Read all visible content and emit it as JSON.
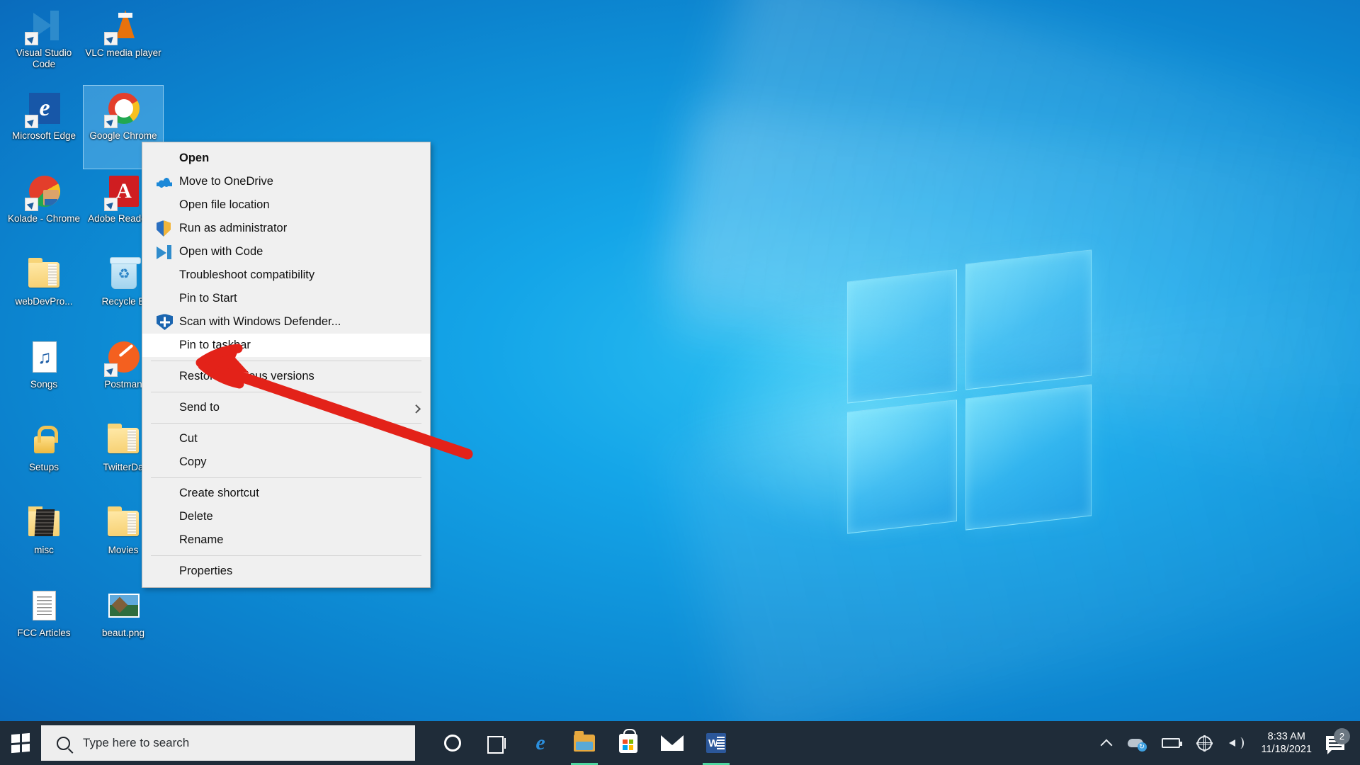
{
  "desktop": {
    "icons": [
      {
        "label": "Visual Studio Code",
        "art": "vscode",
        "shortcut": true,
        "selected": false
      },
      {
        "label": "VLC media player",
        "art": "vlc",
        "shortcut": true,
        "selected": false
      },
      {
        "label": "Microsoft Edge",
        "art": "edge",
        "shortcut": true,
        "selected": false
      },
      {
        "label": "Google Chrome",
        "art": "chrome",
        "shortcut": true,
        "selected": true
      },
      {
        "label": "Kolade - Chrome",
        "art": "kolade",
        "shortcut": true,
        "selected": false
      },
      {
        "label": "Adobe Reader X",
        "art": "acrobat",
        "shortcut": true,
        "selected": false
      },
      {
        "label": "webDevPro...",
        "art": "folder",
        "shortcut": false,
        "selected": false
      },
      {
        "label": "Recycle B",
        "art": "recycle",
        "shortcut": false,
        "selected": false
      },
      {
        "label": "Songs",
        "art": "music",
        "shortcut": false,
        "selected": false
      },
      {
        "label": "Postman",
        "art": "postman",
        "shortcut": true,
        "selected": false
      },
      {
        "label": "Setups",
        "art": "lock",
        "shortcut": false,
        "selected": false
      },
      {
        "label": "TwitterDa",
        "art": "folder",
        "shortcut": false,
        "selected": false
      },
      {
        "label": "misc",
        "art": "darkfolder",
        "shortcut": false,
        "selected": false
      },
      {
        "label": "Movies",
        "art": "folder",
        "shortcut": false,
        "selected": false
      },
      {
        "label": "FCC Articles",
        "art": "docstack",
        "shortcut": false,
        "selected": false
      },
      {
        "label": "beaut.png",
        "art": "photo",
        "shortcut": false,
        "selected": false
      }
    ]
  },
  "context_menu": {
    "items": [
      {
        "label": "Open",
        "icon": null,
        "bold": true,
        "highlighted": false,
        "submenu": false
      },
      {
        "label": "Move to OneDrive",
        "icon": "onedrive-icon",
        "bold": false,
        "highlighted": false,
        "submenu": false
      },
      {
        "label": "Open file location",
        "icon": null,
        "bold": false,
        "highlighted": false,
        "submenu": false
      },
      {
        "label": "Run as administrator",
        "icon": "shield-icon",
        "bold": false,
        "highlighted": false,
        "submenu": false
      },
      {
        "label": "Open with Code",
        "icon": "vscode-icon",
        "bold": false,
        "highlighted": false,
        "submenu": false
      },
      {
        "label": "Troubleshoot compatibility",
        "icon": null,
        "bold": false,
        "highlighted": false,
        "submenu": false
      },
      {
        "label": "Pin to Start",
        "icon": null,
        "bold": false,
        "highlighted": false,
        "submenu": false
      },
      {
        "label": "Scan with Windows Defender...",
        "icon": "defender-icon",
        "bold": false,
        "highlighted": false,
        "submenu": false
      },
      {
        "label": "Pin to taskbar",
        "icon": null,
        "bold": false,
        "highlighted": true,
        "submenu": false
      },
      {
        "separator": true
      },
      {
        "label": "Restore previous versions",
        "icon": null,
        "bold": false,
        "highlighted": false,
        "submenu": false
      },
      {
        "separator": true
      },
      {
        "label": "Send to",
        "icon": null,
        "bold": false,
        "highlighted": false,
        "submenu": true
      },
      {
        "separator": true
      },
      {
        "label": "Cut",
        "icon": null,
        "bold": false,
        "highlighted": false,
        "submenu": false
      },
      {
        "label": "Copy",
        "icon": null,
        "bold": false,
        "highlighted": false,
        "submenu": false
      },
      {
        "separator": true
      },
      {
        "label": "Create shortcut",
        "icon": null,
        "bold": false,
        "highlighted": false,
        "submenu": false
      },
      {
        "label": "Delete",
        "icon": null,
        "bold": false,
        "highlighted": false,
        "submenu": false
      },
      {
        "label": "Rename",
        "icon": null,
        "bold": false,
        "highlighted": false,
        "submenu": false
      },
      {
        "separator": true
      },
      {
        "label": "Properties",
        "icon": null,
        "bold": false,
        "highlighted": false,
        "submenu": false
      }
    ]
  },
  "annotation": {
    "type": "red-arrow",
    "color": "#e32219",
    "points_to": "Pin to taskbar"
  },
  "taskbar": {
    "start_label": "Start",
    "search": {
      "placeholder": "Type here to search",
      "value": ""
    },
    "apps": [
      {
        "name": "cortana",
        "label": "Cortana",
        "running": false
      },
      {
        "name": "task-view",
        "label": "Task View",
        "running": false
      },
      {
        "name": "edge",
        "label": "Microsoft Edge",
        "running": false
      },
      {
        "name": "file-explorer",
        "label": "File Explorer",
        "running": true
      },
      {
        "name": "microsoft-store",
        "label": "Microsoft Store",
        "running": false
      },
      {
        "name": "mail",
        "label": "Mail",
        "running": false
      },
      {
        "name": "word",
        "label": "Microsoft Word",
        "running": true
      }
    ],
    "tray": [
      {
        "name": "show-hidden-icons",
        "label": "Show hidden icons"
      },
      {
        "name": "onedrive",
        "label": "OneDrive"
      },
      {
        "name": "battery",
        "label": "Battery"
      },
      {
        "name": "network",
        "label": "Network - No internet access"
      },
      {
        "name": "volume",
        "label": "Speakers"
      }
    ],
    "clock": {
      "time": "8:33 AM",
      "date": "11/18/2021"
    },
    "action_center": {
      "label": "Notifications",
      "badge": "2"
    }
  },
  "colors": {
    "desktop_accent": "#0b8fd4",
    "taskbar": "#1f2c39",
    "menu_bg": "#f0f0f0",
    "menu_highlight": "#ffffff",
    "annotation_red": "#e32219",
    "running_underline": "#4fd6a0"
  }
}
